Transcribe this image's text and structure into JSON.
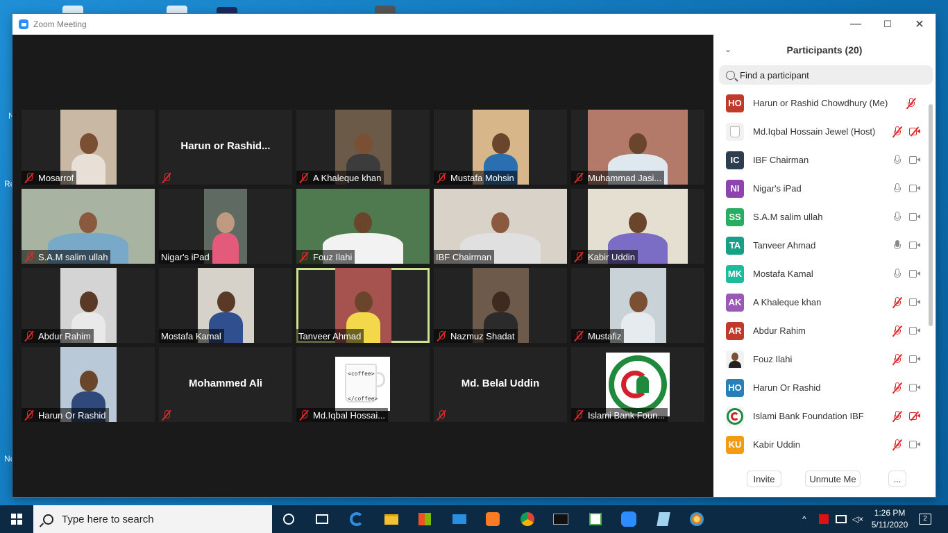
{
  "window": {
    "title": "Zoom Meeting"
  },
  "desktop_fragments": {
    "t1": "N",
    "t2": "Re",
    "t3": "Ne"
  },
  "tiles": [
    {
      "name": "Mosarrof",
      "video": true
    },
    {
      "name": "Harun  or  Rashid...",
      "video": false,
      "label": ""
    },
    {
      "name": "A Khaleque khan",
      "video": true
    },
    {
      "name": "Mustafa Mohsin",
      "video": true
    },
    {
      "name": "Muhammad Jasi...",
      "video": true
    },
    {
      "name": "S.A.M salim ullah",
      "video": true
    },
    {
      "name": "Nigar's iPad",
      "video": true
    },
    {
      "name": "Fouz Ilahi",
      "video": true
    },
    {
      "name": "IBF Chairman",
      "video": true
    },
    {
      "name": "Kabir Uddin",
      "video": true
    },
    {
      "name": "Abdur Rahim",
      "video": true
    },
    {
      "name": "Mostafa Kamal",
      "video": true
    },
    {
      "name": "Tanveer Ahmad",
      "video": true,
      "active": true
    },
    {
      "name": "Nazmuz Shadat",
      "video": true
    },
    {
      "name": "Mustafiz",
      "video": true
    },
    {
      "name": "Harun Or Rashid",
      "video": true
    },
    {
      "name": "Mohammed Ali",
      "video": false
    },
    {
      "name": "Md.Iqbal Hossai...",
      "video": true
    },
    {
      "name": "Md. Belal Uddin",
      "video": false
    },
    {
      "name": "Islami Bank Foun...",
      "video": true
    }
  ],
  "coffee_mug": {
    "top": "<coffee>",
    "bottom": "</coffee>"
  },
  "participants": {
    "title": "Participants (20)",
    "search_placeholder": "Find a participant",
    "list": [
      {
        "initials": "HO",
        "name": "Harun or Rashid Chowdhury (Me)",
        "color": "#c0392b",
        "mic": "off",
        "cam": "none"
      },
      {
        "initials": "",
        "name": "Md.Iqbal Hossain Jewel (Host)",
        "color": "#f2f2f2",
        "mic": "off",
        "cam": "off"
      },
      {
        "initials": "IC",
        "name": "IBF Chairman",
        "color": "#2c3e50",
        "mic": "on",
        "cam": "on"
      },
      {
        "initials": "NI",
        "name": "Nigar's iPad",
        "color": "#8e44ad",
        "mic": "on",
        "cam": "on"
      },
      {
        "initials": "SS",
        "name": "S.A.M salim ullah",
        "color": "#27ae60",
        "mic": "on",
        "cam": "on"
      },
      {
        "initials": "TA",
        "name": "Tanveer Ahmad",
        "color": "#16a085",
        "mic": "talk",
        "cam": "on"
      },
      {
        "initials": "MK",
        "name": "Mostafa Kamal",
        "color": "#1abc9c",
        "mic": "on",
        "cam": "on"
      },
      {
        "initials": "AK",
        "name": "A Khaleque khan",
        "color": "#9b59b6",
        "mic": "off",
        "cam": "on"
      },
      {
        "initials": "AR",
        "name": "Abdur Rahim",
        "color": "#c0392b",
        "mic": "off",
        "cam": "on"
      },
      {
        "initials": "",
        "name": "Fouz Ilahi",
        "color": "#f2f2f2",
        "mic": "off",
        "cam": "on"
      },
      {
        "initials": "HO",
        "name": "Harun Or Rashid",
        "color": "#2980b9",
        "mic": "off",
        "cam": "on"
      },
      {
        "initials": "",
        "name": "Islami Bank Foundation IBF",
        "color": "#f2f2f2",
        "mic": "off",
        "cam": "off"
      },
      {
        "initials": "KU",
        "name": "Kabir Uddin",
        "color": "#f39c12",
        "mic": "off",
        "cam": "on"
      }
    ],
    "buttons": {
      "invite": "Invite",
      "unmute": "Unmute Me",
      "more": "..."
    }
  },
  "taskbar": {
    "search_placeholder": "Type here to search",
    "time": "1:26 PM",
    "date": "5/11/2020",
    "notifications": "2"
  }
}
